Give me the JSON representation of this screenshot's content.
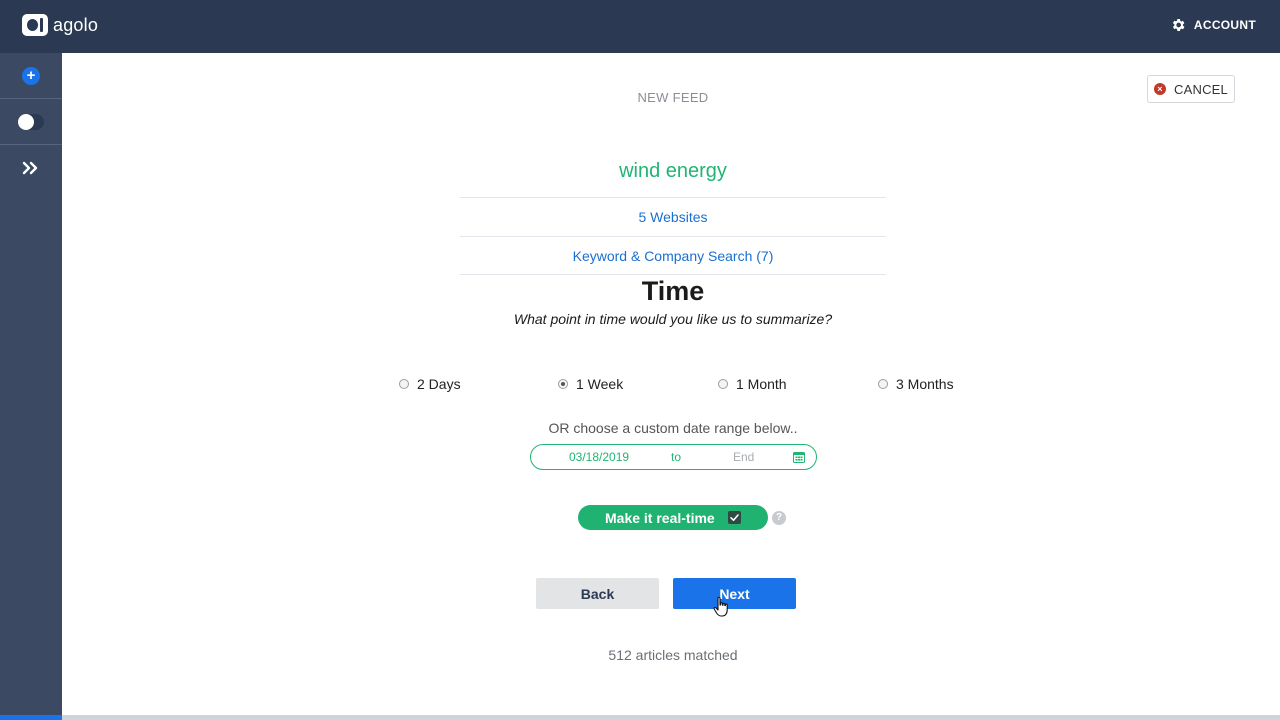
{
  "header": {
    "brand": "agolo",
    "account_label": "ACCOUNT"
  },
  "sidebar": {
    "items": [
      {
        "name": "new-feed",
        "icon": "plus-icon"
      },
      {
        "name": "toggle",
        "icon": "toggle-switch"
      },
      {
        "name": "expand",
        "icon": "double-chevron-right-icon"
      }
    ]
  },
  "page": {
    "heading": "NEW FEED",
    "cancel_label": "CANCEL",
    "feed_name": "wind energy",
    "sources_summary": "5 Websites",
    "search_summary": "Keyword & Company Search (7)"
  },
  "time": {
    "title": "Time",
    "subtitle": "What point in time would you like us to summarize?",
    "options": [
      {
        "label": "2 Days",
        "selected": false
      },
      {
        "label": "1 Week",
        "selected": true
      },
      {
        "label": "1 Month",
        "selected": false
      },
      {
        "label": "3 Months",
        "selected": false
      }
    ],
    "custom_label": "OR choose a custom date range below..",
    "start_date": "03/18/2019",
    "to_label": "to",
    "end_placeholder": "End"
  },
  "realtime": {
    "label": "Make it real-time",
    "checked": true,
    "help": "?"
  },
  "actions": {
    "back_label": "Back",
    "next_label": "Next"
  },
  "status": {
    "matched": "512 articles matched"
  },
  "colors": {
    "topbar": "#2b3a52",
    "sidebar": "#3b4a62",
    "accent_green": "#21b573",
    "accent_blue": "#1a73e8",
    "link_blue": "#1a6fd1"
  }
}
